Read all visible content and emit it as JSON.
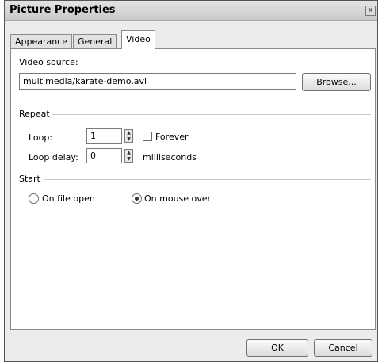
{
  "window": {
    "title": "Picture Properties",
    "close_glyph": "x"
  },
  "tabs": [
    {
      "label": "Appearance",
      "active": false
    },
    {
      "label": "General",
      "active": false
    },
    {
      "label": "Video",
      "active": true
    }
  ],
  "video_source": {
    "label": "Video source:",
    "value": "multimedia/karate-demo.avi",
    "browse_label": "Browse..."
  },
  "repeat": {
    "group_label": "Repeat",
    "loop_label": "Loop:",
    "loop_value": "1",
    "forever_label": "Forever",
    "forever_checked": false,
    "delay_label": "Loop delay:",
    "delay_value": "0",
    "delay_unit": "milliseconds"
  },
  "start": {
    "group_label": "Start",
    "options": [
      {
        "label": "On file open",
        "selected": false
      },
      {
        "label": "On mouse over",
        "selected": true
      }
    ]
  },
  "footer": {
    "ok_label": "OK",
    "cancel_label": "Cancel"
  }
}
